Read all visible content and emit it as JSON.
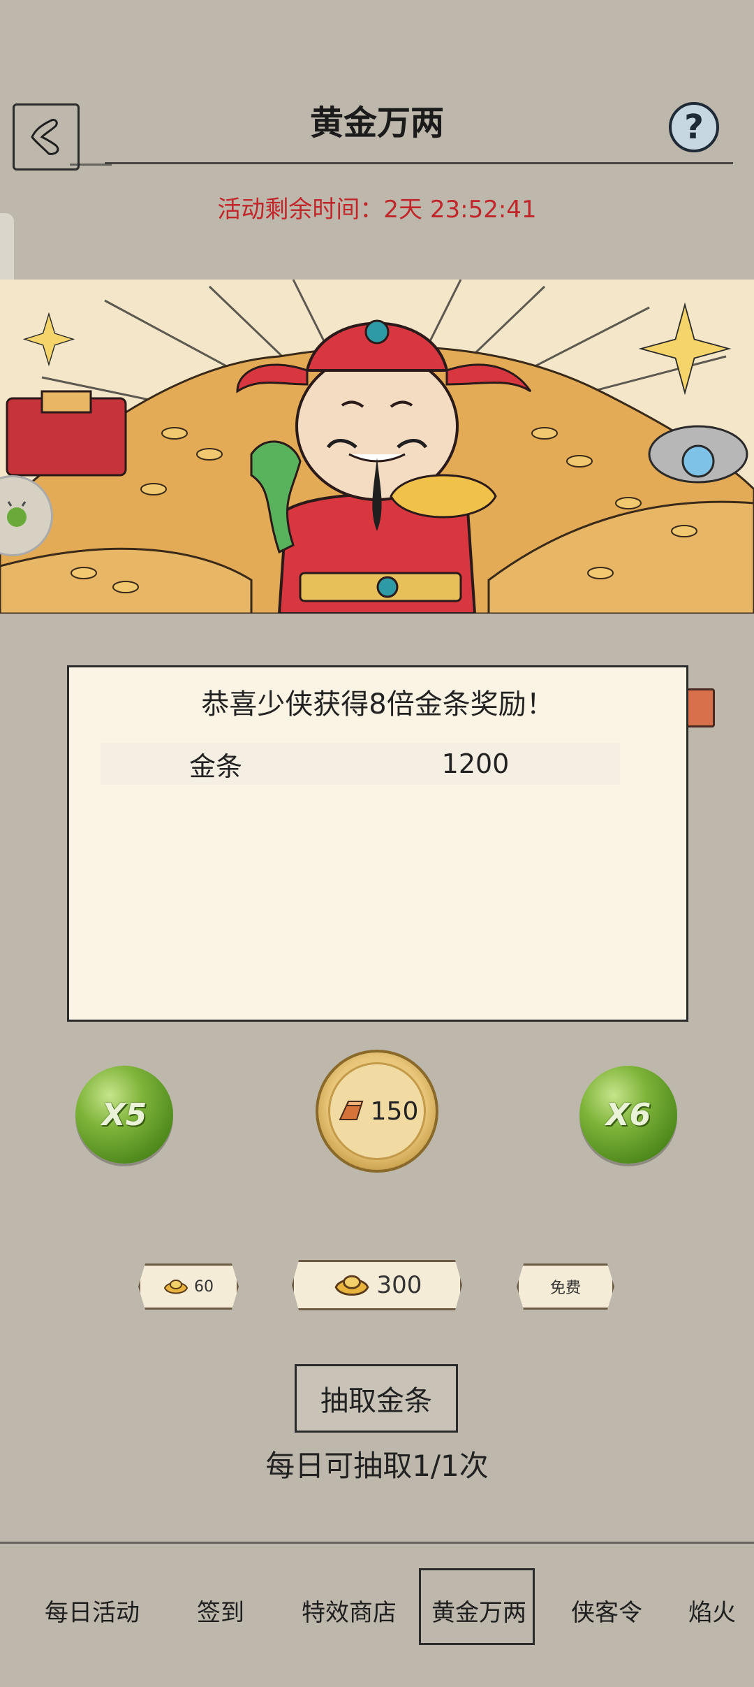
{
  "header": {
    "title": "黄金万两",
    "help_symbol": "?",
    "timer_text": "活动剩余时间：2天 23:52:41"
  },
  "dialog": {
    "title": "恭喜少侠获得8倍金条奖励！",
    "reward_name": "金条",
    "reward_value": "1200"
  },
  "orbs": {
    "left_label": "X5",
    "right_label": "X6"
  },
  "coin": {
    "value": "150",
    "icon": "gold-bar-icon"
  },
  "price_tags": [
    {
      "label": "60",
      "icon": "gold-ingot-icon"
    },
    {
      "label": "300",
      "icon": "gold-ingot-icon"
    },
    {
      "label": "免费"
    }
  ],
  "draw": {
    "button_label": "抽取金条",
    "limit_text": "每日可抽取1/1次"
  },
  "nav": {
    "items": [
      {
        "label": "每日活动"
      },
      {
        "label": "签到"
      },
      {
        "label": "特效商店"
      },
      {
        "label": "黄金万两",
        "active": true
      },
      {
        "label": "侠客令"
      },
      {
        "label": "焰火"
      }
    ]
  },
  "colors": {
    "background": "#bdb8ab",
    "timer_red": "#c1262b",
    "dialog_bg": "#fbf4e4",
    "orb_green": "#6fa52f",
    "gold": "#e8c67a"
  }
}
